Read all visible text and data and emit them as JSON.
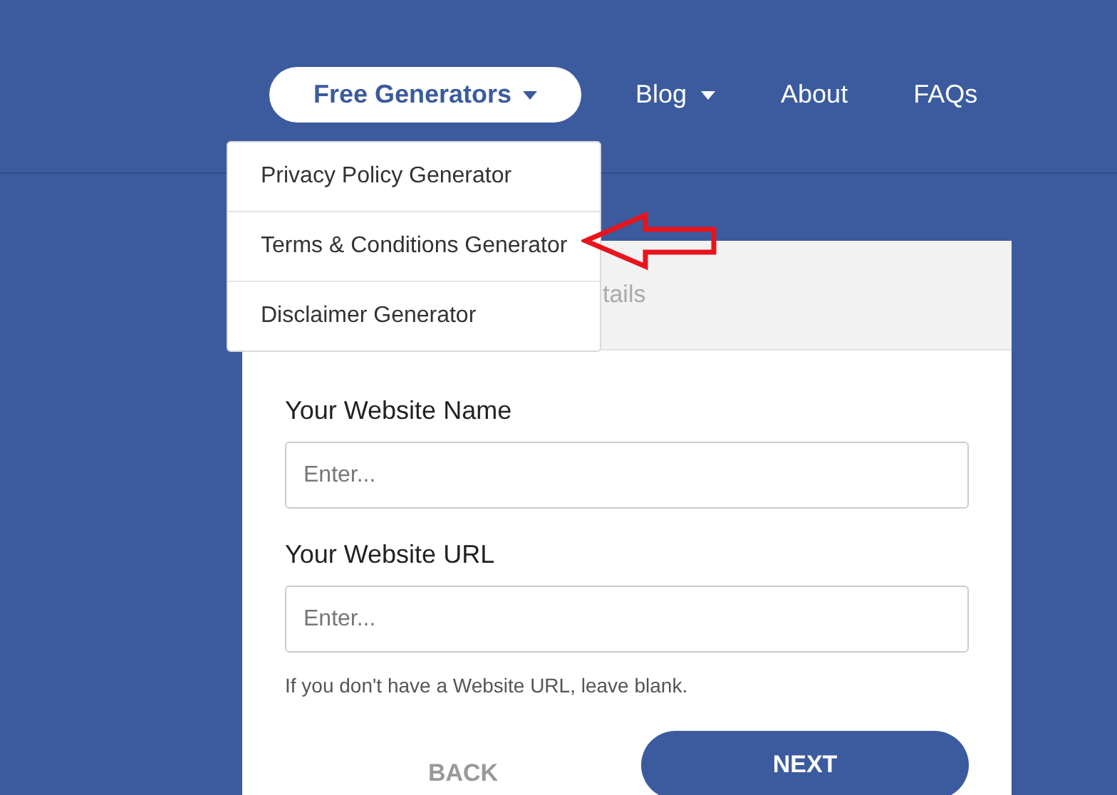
{
  "nav": {
    "items": [
      {
        "label": "Free Generators",
        "kind": "pill",
        "caret": true
      },
      {
        "label": "Blog",
        "kind": "link",
        "caret": true
      },
      {
        "label": "About",
        "kind": "link",
        "caret": false
      },
      {
        "label": "FAQs",
        "kind": "link",
        "caret": false
      }
    ]
  },
  "dropdown": {
    "items": [
      {
        "label": "Privacy Policy Generator",
        "annotated": false
      },
      {
        "label": "Terms & Conditions Generator",
        "annotated": true
      },
      {
        "label": "Disclaimer Generator",
        "annotated": false
      }
    ]
  },
  "card": {
    "header": "tails",
    "fields": [
      {
        "label": "Your Website Name",
        "placeholder": "Enter..."
      },
      {
        "label": "Your Website URL",
        "placeholder": "Enter...",
        "hint": "If you don't have a Website URL, leave blank."
      }
    ],
    "buttons": [
      {
        "label": "BACK",
        "kind": "text"
      },
      {
        "label": "NEXT",
        "kind": "primary"
      }
    ]
  }
}
